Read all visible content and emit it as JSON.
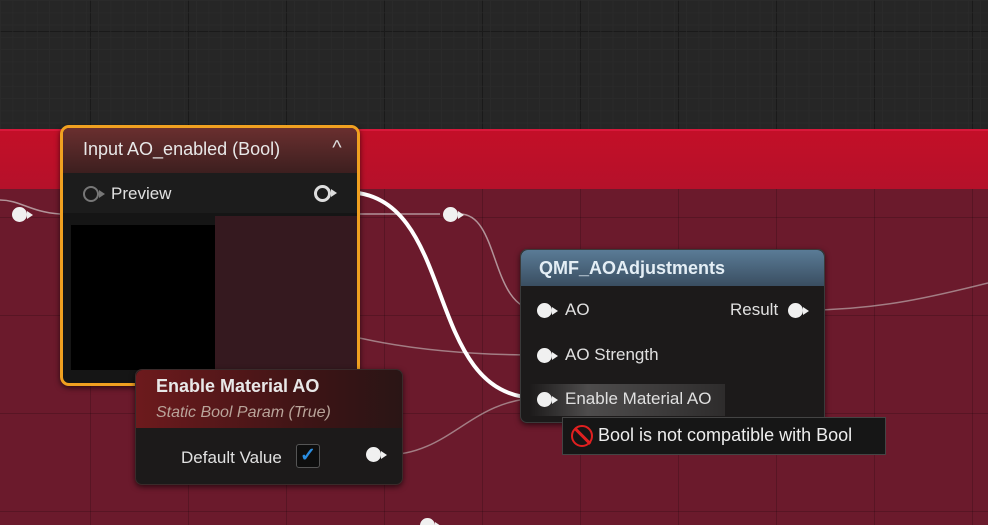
{
  "input_node": {
    "title": "Input AO_enabled (Bool)",
    "collapse_glyph": "^",
    "preview_label": "Preview"
  },
  "static_bool_node": {
    "title": "Enable Material AO",
    "subtitle": "Static Bool Param (True)",
    "default_value_label": "Default Value",
    "default_value_checked": true
  },
  "function_node": {
    "title": "QMF_AOAdjustments",
    "inputs": [
      "AO",
      "AO Strength",
      "Enable Material AO"
    ],
    "output": "Result"
  },
  "tooltip": {
    "message": "Bool is not compatible with Bool",
    "icon": "no-entry-icon"
  },
  "colors": {
    "comment_header": "#c30f28",
    "comment_body": "#6b1a2c",
    "selection_outline": "#f0a020",
    "function_header": "#4a6880"
  }
}
